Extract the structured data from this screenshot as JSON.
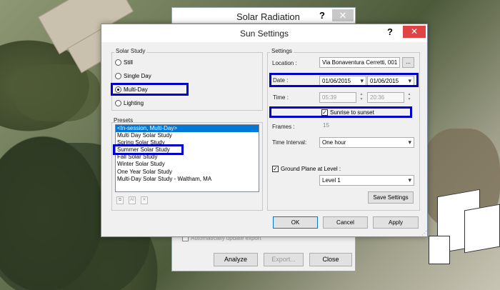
{
  "solar_radiation": {
    "title": "Solar Radiation",
    "help": "?",
    "close": "✕",
    "auto_update": "Automatically update export",
    "analyze": "Analyze",
    "export": "Export...",
    "close_btn": "Close"
  },
  "dialog": {
    "title": "Sun Settings",
    "help": "?",
    "close": "✕"
  },
  "solar_study": {
    "group_label": "Solar Study",
    "options": [
      "Still",
      "Single Day",
      "Multi-Day",
      "Lighting"
    ],
    "selected": "Multi-Day"
  },
  "presets": {
    "group_label": "Presets",
    "items": [
      "<In-session, Multi-Day>",
      "Multi Day Solar Study",
      "Spring Solar Study",
      "Summer Solar Study",
      "Fall Solar Study",
      "Winter Solar Study",
      "One Year Solar Study",
      "Multi-Day Solar Study - Waltham, MA"
    ],
    "selected_index": 0
  },
  "settings": {
    "group_label": "Settings",
    "location_label": "Location :",
    "location_value": "Via Bonaventura Cerretti, 001",
    "browse": "...",
    "date_label": "Date :",
    "date_from": "01/06/2015",
    "date_to": "01/06/2015",
    "time_label": "Time :",
    "time_from": "05:39",
    "time_to": "20:36",
    "sunrise_label": "Sunrise to sunset",
    "frames_label": "Frames :",
    "frames_value": "15",
    "interval_label": "Time Interval:",
    "interval_value": "One hour",
    "ground_plane_label": "Ground Plane at Level :",
    "level_value": "Level 1",
    "save_settings": "Save Settings"
  },
  "footer": {
    "ok": "OK",
    "cancel": "Cancel",
    "apply": "Apply"
  },
  "colors": {
    "highlight": "#0000cc",
    "selection": "#0078d7",
    "close_red": "#e04343"
  }
}
